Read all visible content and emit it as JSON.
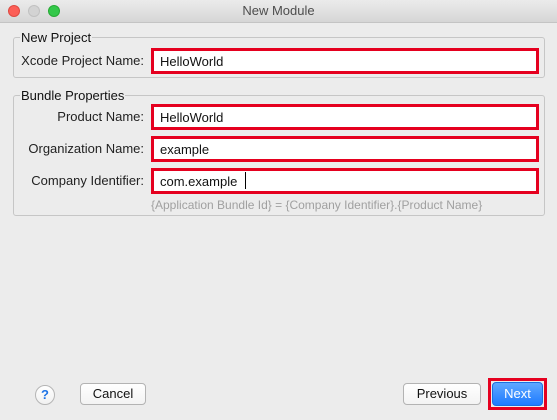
{
  "window": {
    "title": "New Module"
  },
  "project_group": {
    "title": "New Project",
    "xcode_project_name": {
      "label": "Xcode Project Name:",
      "value": "HelloWorld"
    }
  },
  "bundle_group": {
    "title": "Bundle Properties",
    "product_name": {
      "label": "Product Name:",
      "value": "HelloWorld"
    },
    "organization_name": {
      "label": "Organization Name:",
      "value": "example"
    },
    "company_identifier": {
      "label": "Company Identifier:",
      "value": "com.example"
    },
    "hint": "{Application Bundle Id} = {Company Identifier}.{Product Name}"
  },
  "footer": {
    "help_label": "?",
    "cancel_label": "Cancel",
    "previous_label": "Previous",
    "next_label": "Next"
  },
  "colors": {
    "highlight": "#e5001f",
    "primary_button": "#1e7bff",
    "close": "#fc5f57",
    "zoom": "#34c84a"
  },
  "icons": {
    "help": "help-icon"
  }
}
